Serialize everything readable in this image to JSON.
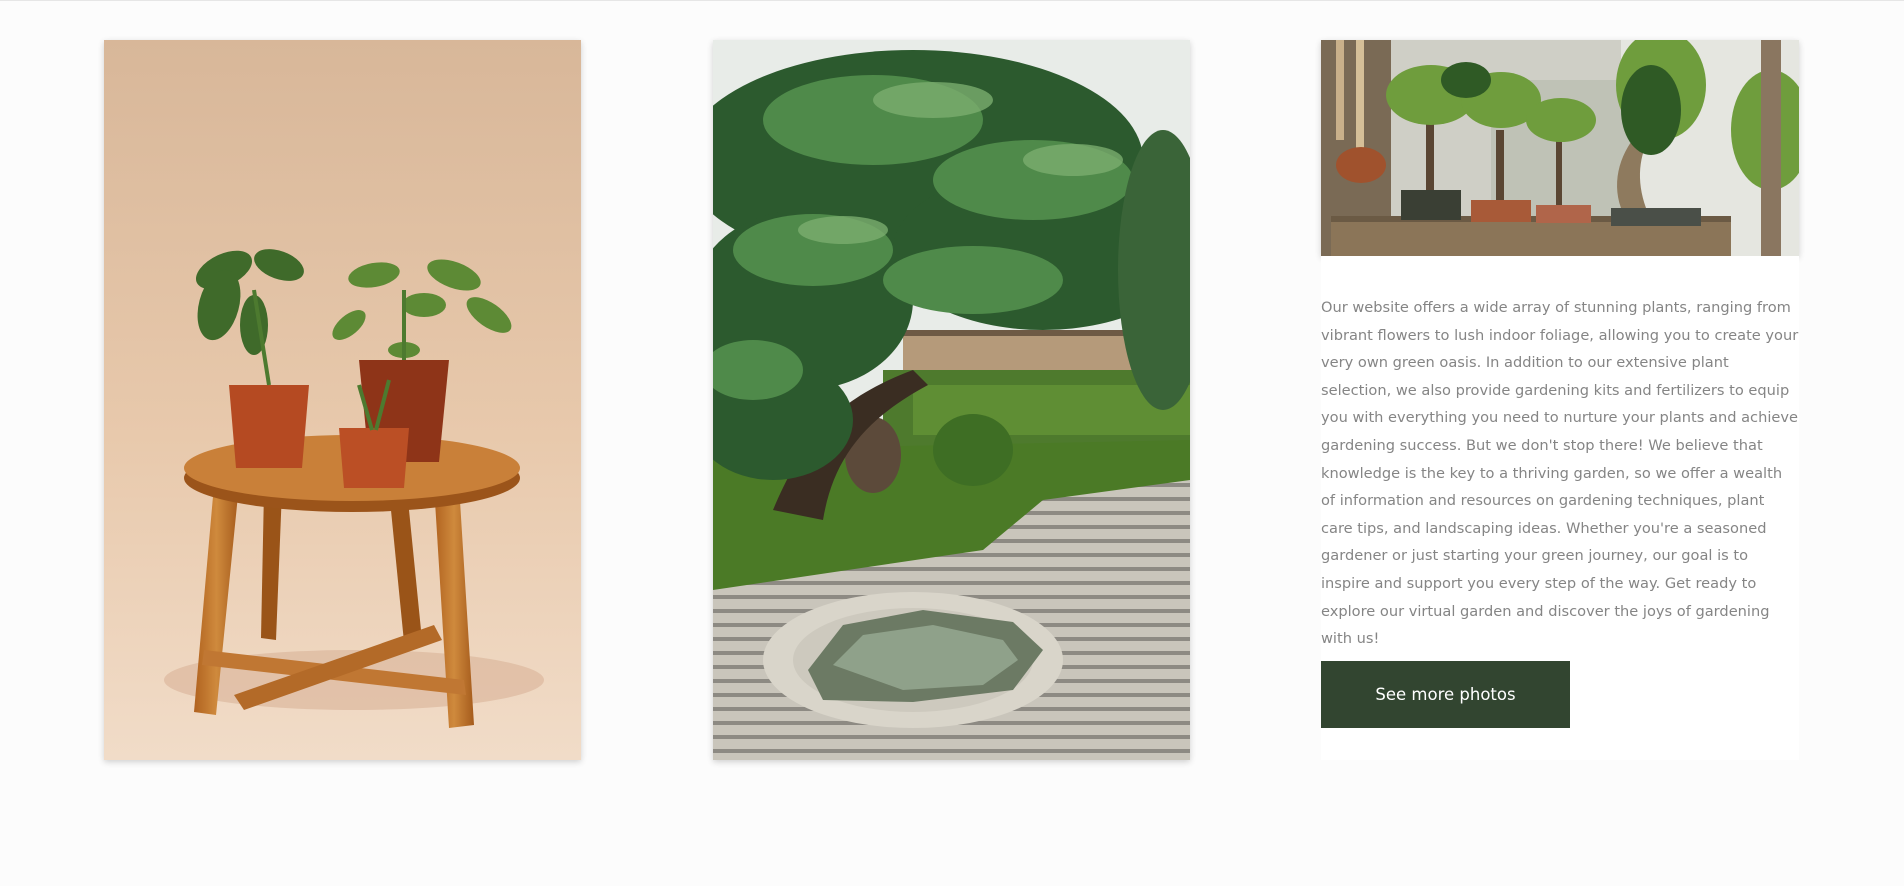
{
  "gallery": {
    "photos": [
      {
        "icon": "potted-plants-on-wooden-stool-photo"
      },
      {
        "icon": "japanese-zen-garden-pine-tree-photo"
      },
      {
        "icon": "bonsai-trees-on-shelf-photo"
      }
    ],
    "description": "Our website offers a wide array of stunning plants, ranging from vibrant flowers to lush indoor foliage, allowing you to create your very own green oasis. In addition to our extensive plant selection, we also provide gardening kits and fertilizers to equip you with everything you need to nurture your plants and achieve gardening success. But we don't stop there! We believe that knowledge is the key to a thriving garden, so we offer a wealth of information and resources on gardening techniques, plant care tips, and landscaping ideas. Whether you're a seasoned gardener or just starting your green journey, our goal is to inspire and support you every step of the way. Get ready to explore our virtual garden and discover the joys of gardening with us!",
    "button_label": "See more photos"
  },
  "colors": {
    "background": "#fcfcfc",
    "button_bg": "#324530",
    "button_text": "#ffffff",
    "body_text": "#858585"
  }
}
